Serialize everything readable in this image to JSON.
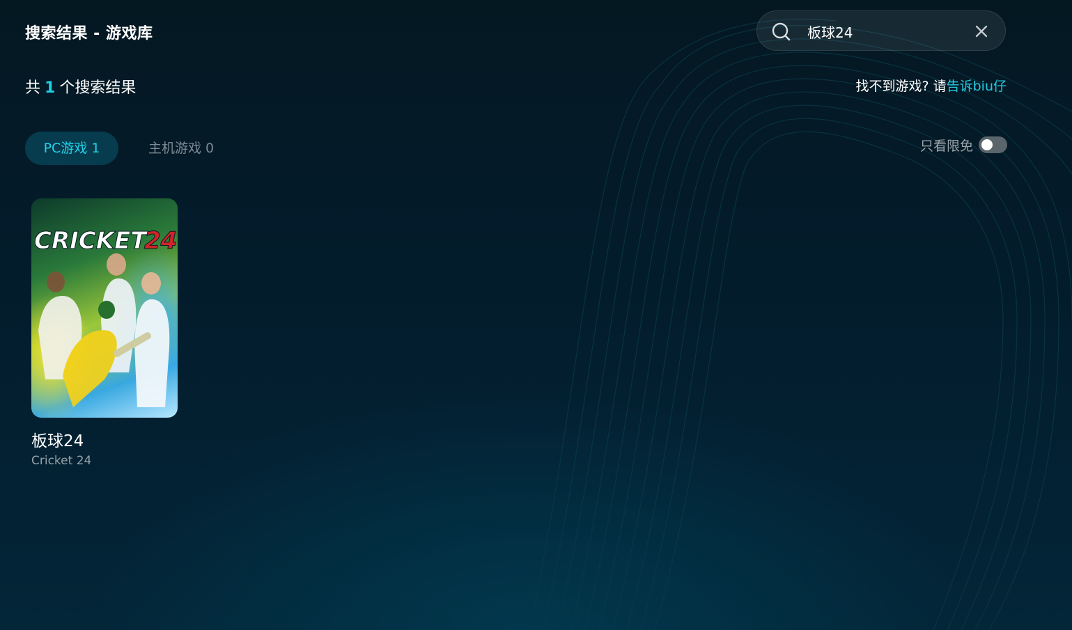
{
  "page": {
    "title": "搜索结果 - 游戏库"
  },
  "search": {
    "query": "板球24"
  },
  "results": {
    "prefix": "共",
    "count": "1",
    "suffix": "个搜索结果"
  },
  "help": {
    "text": "找不到游戏? 请",
    "link": "告诉biu仔"
  },
  "tabs": [
    {
      "label": "PC游戏 1",
      "active": true
    },
    {
      "label": "主机游戏 0",
      "active": false
    }
  ],
  "filter": {
    "free_only_label": "只看限免",
    "free_only_on": false
  },
  "games": [
    {
      "title": "板球24",
      "subtitle": "Cricket 24",
      "cover_logo": "CRICKET",
      "cover_logo_num": "24"
    }
  ],
  "colors": {
    "accent": "#21d0e8",
    "tab_active_bg": "#073b4e",
    "logo_red": "#d2232a"
  }
}
